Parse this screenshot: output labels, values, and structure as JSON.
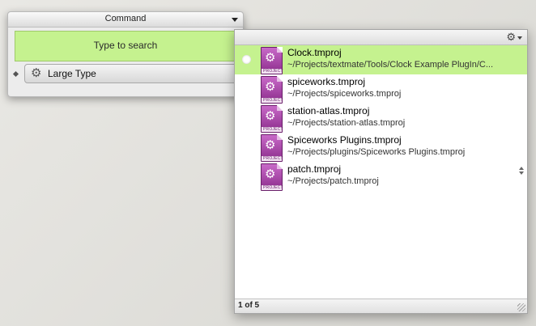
{
  "command_panel": {
    "title": "Command",
    "search_placeholder": "Type to search",
    "action_label": "Large Type",
    "action_icon": "gear-icon"
  },
  "results": {
    "toolbar_icon": "gear-icon",
    "items": [
      {
        "name": "Clock.tmproj",
        "path": "~/Projects/textmate/Tools/Clock Example PlugIn/C...",
        "selected": true,
        "icon": "project-icon"
      },
      {
        "name": "spiceworks.tmproj",
        "path": "~/Projects/spiceworks.tmproj",
        "icon": "project-icon"
      },
      {
        "name": "station-atlas.tmproj",
        "path": "~/Projects/station-atlas.tmproj",
        "icon": "project-icon"
      },
      {
        "name": "Spiceworks Plugins.tmproj",
        "path": "~/Projects/plugins/Spiceworks Plugins.tmproj",
        "icon": "project-icon"
      },
      {
        "name": "patch.tmproj",
        "path": "~/Projects/patch.tmproj",
        "icon": "project-icon"
      }
    ],
    "icon_label": "PROJECT",
    "footer_count": "1 of 5"
  },
  "colors": {
    "selection_green": "#c5f28f",
    "project_purple": "#8b2b8b"
  }
}
